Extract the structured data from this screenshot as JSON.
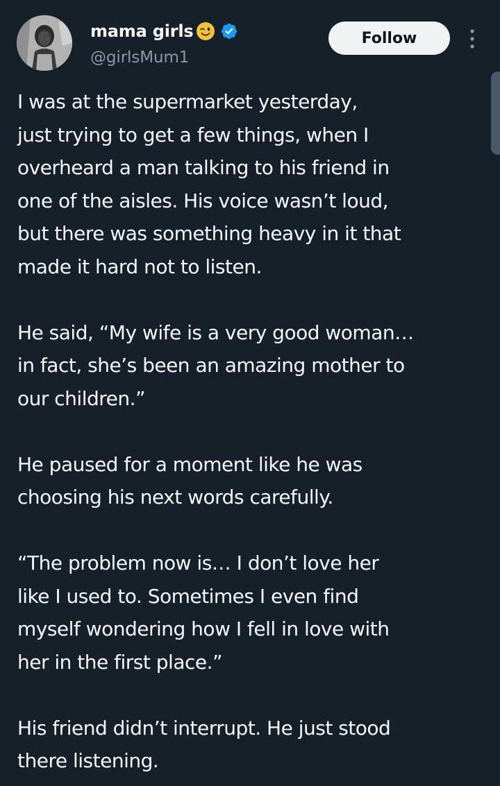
{
  "author": {
    "display_name": "mama girls",
    "emoji": "winking-face-emoji",
    "verified_icon": "verified-badge-icon",
    "handle": "@girlsMum1",
    "avatar": "user-avatar-photo"
  },
  "actions": {
    "follow_label": "Follow",
    "more_icon": "more-vertical-icon"
  },
  "tweet": {
    "paragraphs": [
      [
        "I was at the supermarket yesterday,",
        "just trying to get a few things, when I",
        "overheard a man talking to his friend in",
        "one of the aisles. His voice wasn’t loud,",
        "but there was something heavy in it that",
        "made it hard not to listen."
      ],
      [
        "He said, “My wife is a very good woman…",
        "in fact, she’s been an amazing mother to",
        "our children.”"
      ],
      [
        "He paused for a moment like he was",
        "choosing his next words carefully."
      ],
      [
        "“The problem now is… I don’t love her",
        "like I used to. Sometimes I even find",
        "myself wondering how I fell in love with",
        "her in the first place.”"
      ],
      [
        "His friend didn’t interrupt. He just stood",
        "there listening."
      ]
    ]
  },
  "colors": {
    "background": "#15202b",
    "text_primary": "#f7f9f9",
    "text_secondary": "#8b98a5",
    "follow_bg": "#eff3f4",
    "follow_text": "#0f1419",
    "verified_blue": "#1d9bf0"
  }
}
